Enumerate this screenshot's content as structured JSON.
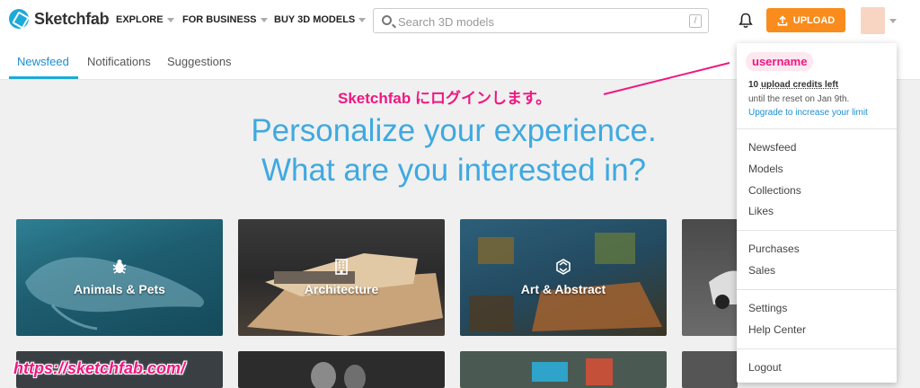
{
  "brand": {
    "name": "Sketchfab",
    "accent": "#1caad9",
    "upload_color": "#f98c1c",
    "highlight": "#ef1881"
  },
  "nav": {
    "explore": "EXPLORE",
    "business": "FOR BUSINESS",
    "buy": "BUY 3D MODELS",
    "search_placeholder": "Search 3D models",
    "search_shortcut": "/",
    "upload": "UPLOAD"
  },
  "tabs": [
    {
      "label": "Newsfeed",
      "active": true
    },
    {
      "label": "Notifications",
      "active": false
    },
    {
      "label": "Suggestions",
      "active": false
    }
  ],
  "hero": {
    "line1": "Personalize your experience.",
    "line2": "What are you interested in?"
  },
  "categories": [
    {
      "label": "Animals & Pets",
      "icon": "bug-icon"
    },
    {
      "label": "Architecture",
      "icon": "building-icon"
    },
    {
      "label": "Art & Abstract",
      "icon": "abstract-icon"
    }
  ],
  "dropdown": {
    "username": "username",
    "credits_count": "10",
    "credits_text": "upload credits left",
    "reset": "until the reset on Jan 9th.",
    "upgrade": "Upgrade to increase your limit",
    "group1": [
      "Newsfeed",
      "Models",
      "Collections",
      "Likes"
    ],
    "group2": [
      "Purchases",
      "Sales"
    ],
    "group3": [
      "Settings",
      "Help Center"
    ],
    "logout": "Logout"
  },
  "annotation": {
    "login": "Sketchfab にログインします。",
    "url": "https://sketchfab.com/"
  }
}
